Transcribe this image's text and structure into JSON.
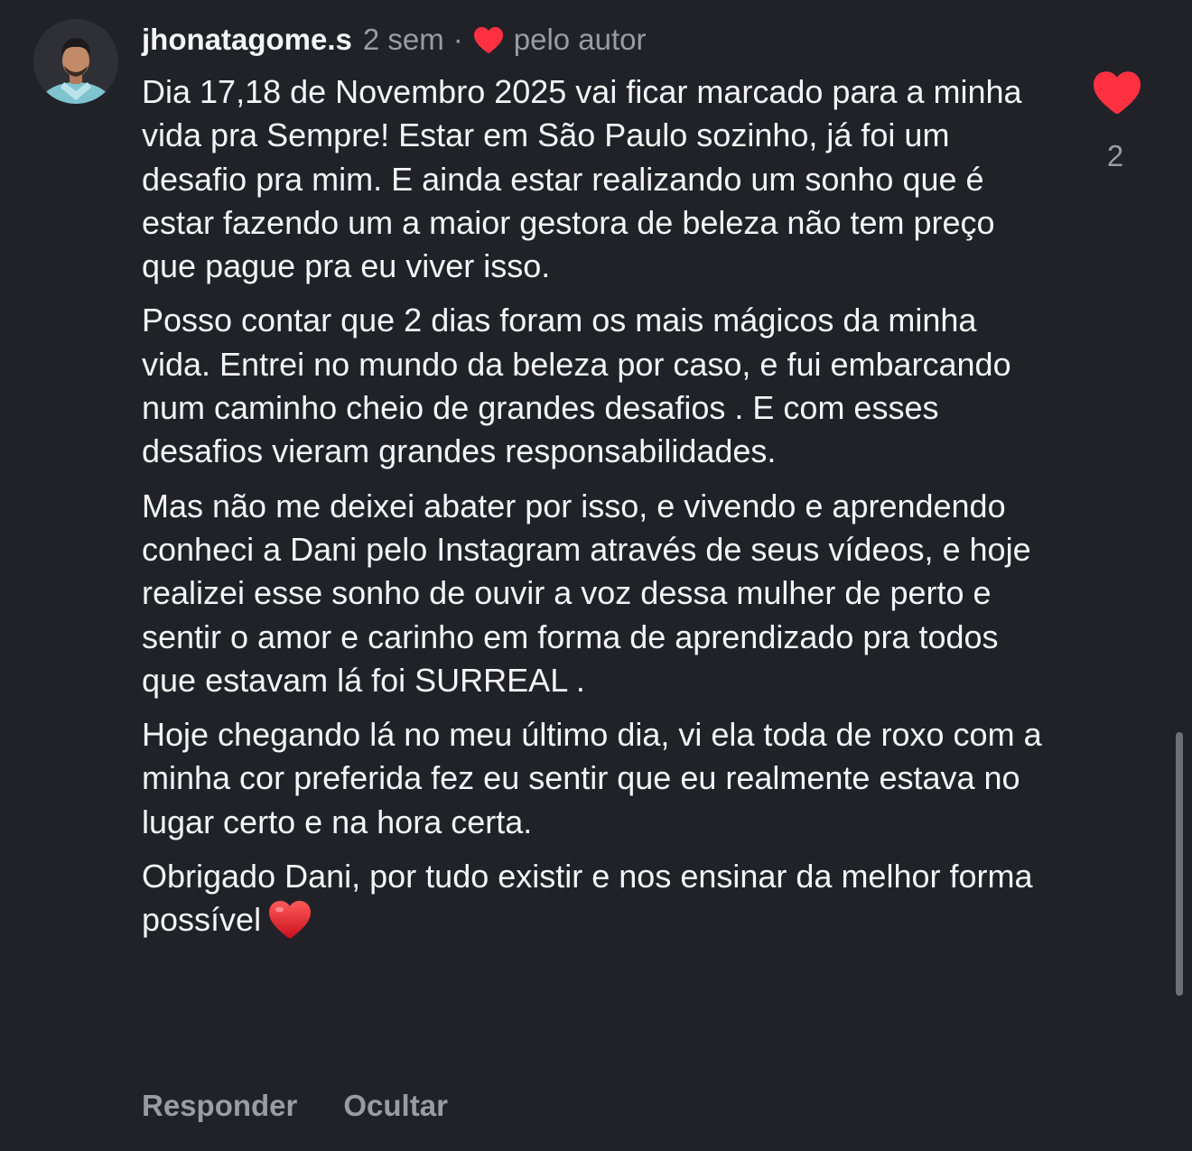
{
  "comment": {
    "username": "jhonatagome.s",
    "time": "2 sem",
    "separator": "·",
    "author_label": "pelo autor",
    "paragraphs": [
      "Dia 17,18 de Novembro 2025 vai ficar marcado para a minha vida pra Sempre! Estar em São Paulo sozinho, já foi um desafio pra mim. E ainda estar realizando um sonho que é estar fazendo um a maior gestora de beleza não tem preço que pague pra eu viver isso.",
      "Posso contar que 2 dias foram os mais mágicos da minha vida. Entrei no mundo da beleza por caso, e fui embarcando num caminho cheio de grandes desafios . E com esses desafios vieram grandes responsabilidades.",
      "Mas não me deixei abater por isso, e vivendo e aprendendo conheci a Dani pelo Instagram através de seus vídeos, e hoje realizei esse sonho de ouvir a voz dessa mulher de perto e sentir o amor e carinho em forma de aprendizado pra todos que estavam lá foi SURREAL .",
      "Hoje chegando lá no meu último dia, vi ela toda de roxo com a minha cor preferida fez eu sentir que eu realmente estava no lugar certo e na hora certa.",
      "Obrigado Dani, por tudo existir e nos ensinar da melhor forma possível"
    ],
    "like_count": "2",
    "actions": {
      "reply": "Responder",
      "hide": "Ocultar"
    }
  },
  "icons": {
    "author_like": "heart-icon",
    "like": "heart-icon",
    "emoji": "red-heart-emoji"
  },
  "colors": {
    "background": "#212228",
    "text": "#f5f5f7",
    "muted": "#9a9ba3",
    "heart": "#ff3040"
  }
}
